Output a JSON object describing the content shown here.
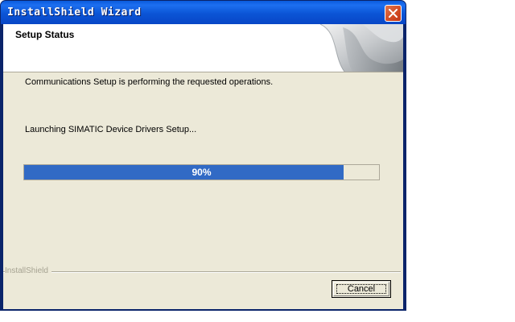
{
  "window": {
    "title": "InstallShield Wizard",
    "close_icon": "close-icon"
  },
  "banner": {
    "title": "Setup Status",
    "art_icon": "wizard-banner-icon"
  },
  "body": {
    "status_message": "Communications Setup is performing the requested operations.",
    "current_action": "Launching SIMATIC Device Drivers Setup..."
  },
  "progress": {
    "percent": 90,
    "label": "90%",
    "fill_color": "#316ac5"
  },
  "footer": {
    "brand_label": "InstallShield",
    "cancel_label": "Cancel"
  },
  "colors": {
    "titlebar": "#0a5bdc",
    "dialog_background": "#ece9d8",
    "close_button": "#d24a22"
  }
}
